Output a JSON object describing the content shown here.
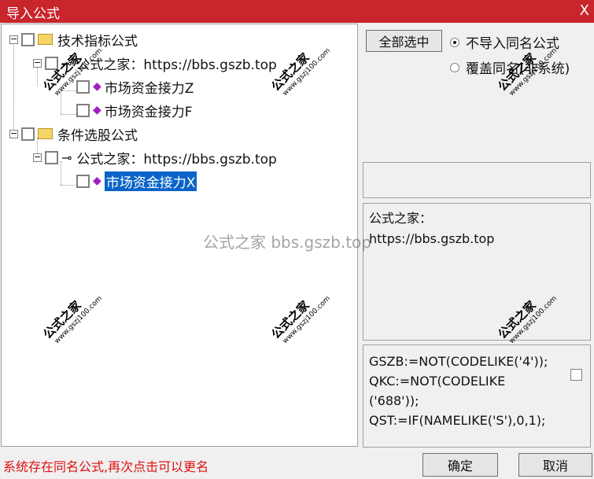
{
  "window": {
    "title": "导入公式",
    "close": "X"
  },
  "tree": {
    "group1": "技术指标公式",
    "group1_source": "公式之家：https://bbs.gszb.top",
    "item_z": "市场资金接力Z",
    "item_f": "市场资金接力F",
    "group2": "条件选股公式",
    "group2_source": "公式之家：https://bbs.gszb.top",
    "item_x": "市场资金接力X"
  },
  "controls": {
    "select_all": "全部选中",
    "radio_no_import": "不导入同名公式",
    "radio_overwrite": "覆盖同名(非系统)"
  },
  "info_text": [
    "公式之家：",
    "https://bbs.gszb.top"
  ],
  "code_lines": [
    "GSZB:=NOT(CODELIKE('4'));",
    "QKC:=NOT(CODELIKE",
    "('688'));",
    "QST:=IF(NAMELIKE('S'),0,1);"
  ],
  "status": "系统存在同名公式,再次点击可以更名",
  "buttons": {
    "ok": "确定",
    "cancel": "取消"
  },
  "overlay_text": "公式之家 bbs.gszb.top",
  "watermark": {
    "main": "公式之家",
    "sub": "www.gszj100.com"
  }
}
